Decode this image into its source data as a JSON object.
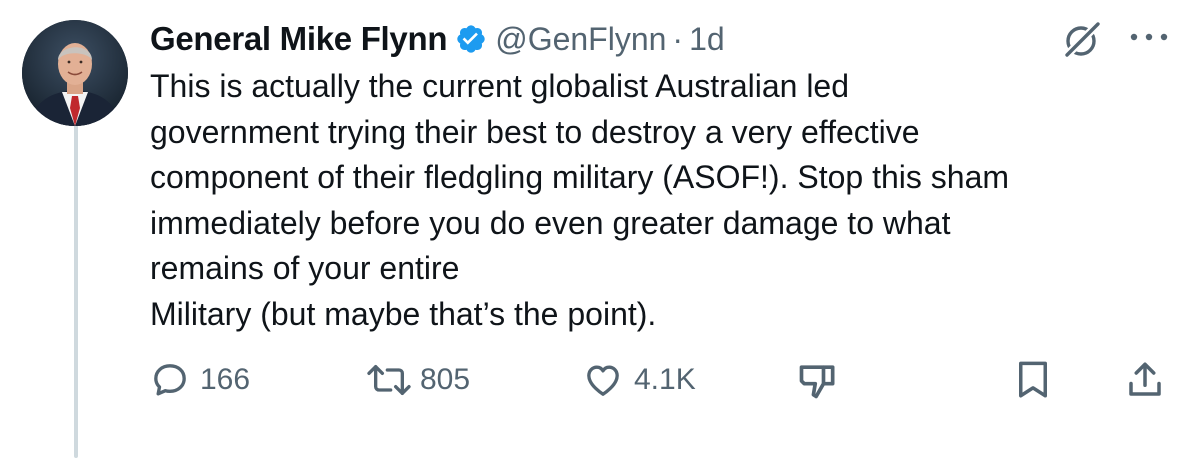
{
  "tweet": {
    "author": {
      "display_name": "General Mike Flynn",
      "handle": "@GenFlynn",
      "separator": "·",
      "time": "1d",
      "verified": true
    },
    "text_lines": [
      "This is actually the current globalist Australian led",
      "government trying their best to destroy a very effective",
      "component of their fledgling military (ASOF!). Stop this sham",
      "immediately before you do even greater damage to what",
      "remains of your entire",
      "Military (but maybe that’s the point)."
    ],
    "actions": {
      "reply": {
        "icon": "reply-icon",
        "count": "166"
      },
      "retweet": {
        "icon": "retweet-icon",
        "count": "805"
      },
      "like": {
        "icon": "heart-icon",
        "count": "4.1K"
      },
      "dislike": {
        "icon": "thumbs-down-icon"
      },
      "bookmark": {
        "icon": "bookmark-icon"
      },
      "share": {
        "icon": "share-icon"
      }
    },
    "top_right": {
      "grok": {
        "icon": "grok-icon"
      },
      "more": {
        "icon": "more-icon"
      }
    }
  },
  "colors": {
    "text_primary": "#0f1419",
    "text_secondary": "#536471",
    "verified_blue": "#1d9bf0",
    "thread_line": "#cfd9de"
  }
}
